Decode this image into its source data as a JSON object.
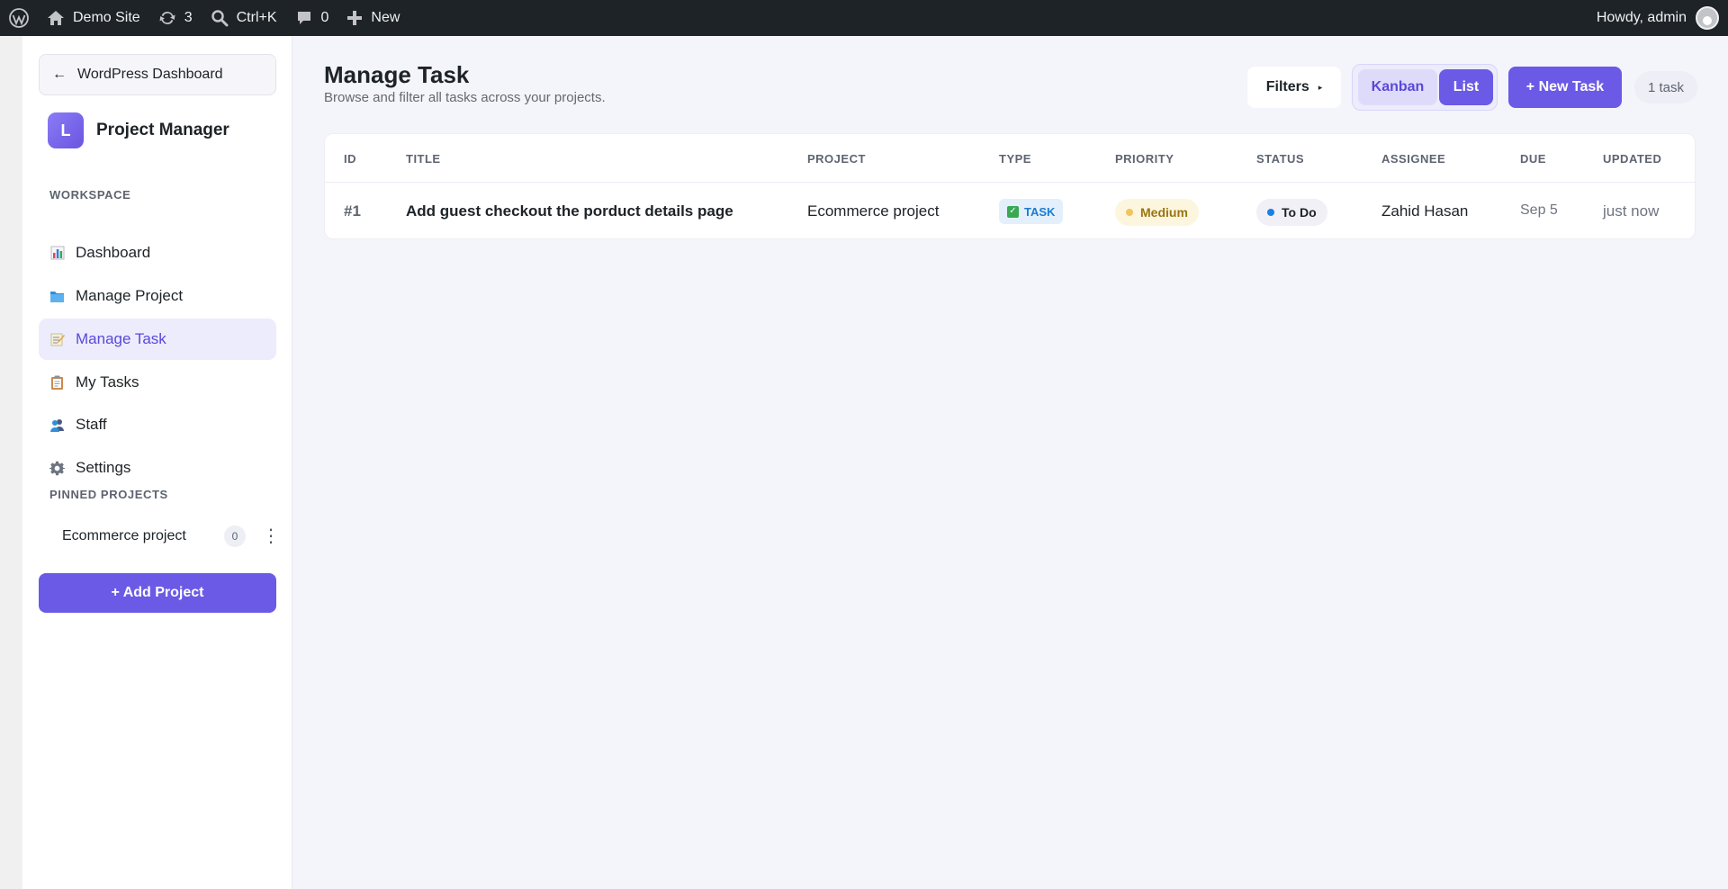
{
  "adminbar": {
    "site_name": "Demo Site",
    "updates_count": "3",
    "search_shortcut": "Ctrl+K",
    "comments_count": "0",
    "new_label": "New",
    "greeting": "Howdy, admin"
  },
  "sidebar": {
    "back_label": "WordPress Dashboard",
    "brand_initial": "L",
    "brand_name": "Project Manager",
    "workspace_label": "WORKSPACE",
    "nav": [
      {
        "label": "Dashboard",
        "icon": "chart-icon"
      },
      {
        "label": "Manage Project",
        "icon": "folder-icon"
      },
      {
        "label": "Manage Task",
        "icon": "memo-icon"
      },
      {
        "label": "My Tasks",
        "icon": "clipboard-icon"
      },
      {
        "label": "Staff",
        "icon": "people-icon"
      },
      {
        "label": "Settings",
        "icon": "gear-icon"
      }
    ],
    "active_index": 2,
    "pinned_label": "PINNED PROJECTS",
    "pinned": [
      {
        "name": "Ecommerce project",
        "count": "0"
      }
    ],
    "add_project_label": "+ Add Project"
  },
  "main": {
    "title": "Manage Task",
    "subtitle": "Browse and filter all tasks across your projects.",
    "filters_label": "Filters",
    "view_kanban": "Kanban",
    "view_list": "List",
    "active_view": "List",
    "new_task_label": "+ New Task",
    "task_count": "1 task",
    "table": {
      "headers": [
        "ID",
        "TITLE",
        "PROJECT",
        "TYPE",
        "PRIORITY",
        "STATUS",
        "ASSIGNEE",
        "DUE",
        "UPDATED"
      ],
      "rows": [
        {
          "id": "#1",
          "title": "Add guest checkout the porduct details page",
          "project": "Ecommerce project",
          "type": "TASK",
          "priority": "Medium",
          "status": "To Do",
          "assignee": "Zahid Hasan",
          "due": "Sep 5",
          "updated": "just now"
        }
      ]
    }
  },
  "colors": {
    "accent": "#6b5ae6",
    "adminbar": "#1d2327",
    "priority_medium_dot": "#f2c55a",
    "status_todo_dot": "#1e7fe0",
    "type_task_check": "#39a852"
  }
}
